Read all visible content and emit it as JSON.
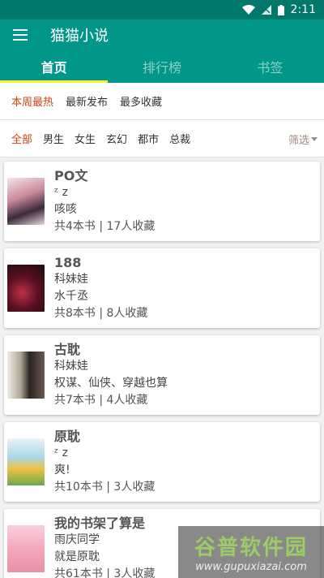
{
  "status": {
    "time": "2:11"
  },
  "app": {
    "title": "猫猫小说"
  },
  "tabs": [
    {
      "label": "首页"
    },
    {
      "label": "排行榜"
    },
    {
      "label": "书签"
    }
  ],
  "sort": [
    "本周最热",
    "最新发布",
    "最多收藏"
  ],
  "categories": [
    "全部",
    "男生",
    "女生",
    "玄幻",
    "都市",
    "总裁"
  ],
  "filter": {
    "label": "筛选"
  },
  "books": [
    {
      "name": "PO文",
      "author": "ᶻ z",
      "desc": "咳咳",
      "meta": "共4本书 | 17人收藏"
    },
    {
      "name": "188",
      "author": "科妹娃",
      "desc": "水千丞",
      "meta": "共8本书 | 8人收藏"
    },
    {
      "name": "古耽",
      "author": "科妹娃",
      "desc": "权谋、仙侠、穿越也算",
      "meta": "共7本书 | 4人收藏"
    },
    {
      "name": "原耽",
      "author": "ᶻ z",
      "desc": "爽!",
      "meta": "共10本书 | 3人收藏"
    },
    {
      "name": "我的书架了算是",
      "author": "雨庆同学",
      "desc": "就是原耽",
      "meta": "共61本书 | 3人收藏"
    }
  ],
  "watermark": {
    "main": "谷普软件园",
    "sub": "www.gupuxiazai.com"
  },
  "colors": {
    "primary": "#009688",
    "primary_dark": "#00796b",
    "indicator": "#ffeb3b",
    "accent": "#d84315"
  }
}
